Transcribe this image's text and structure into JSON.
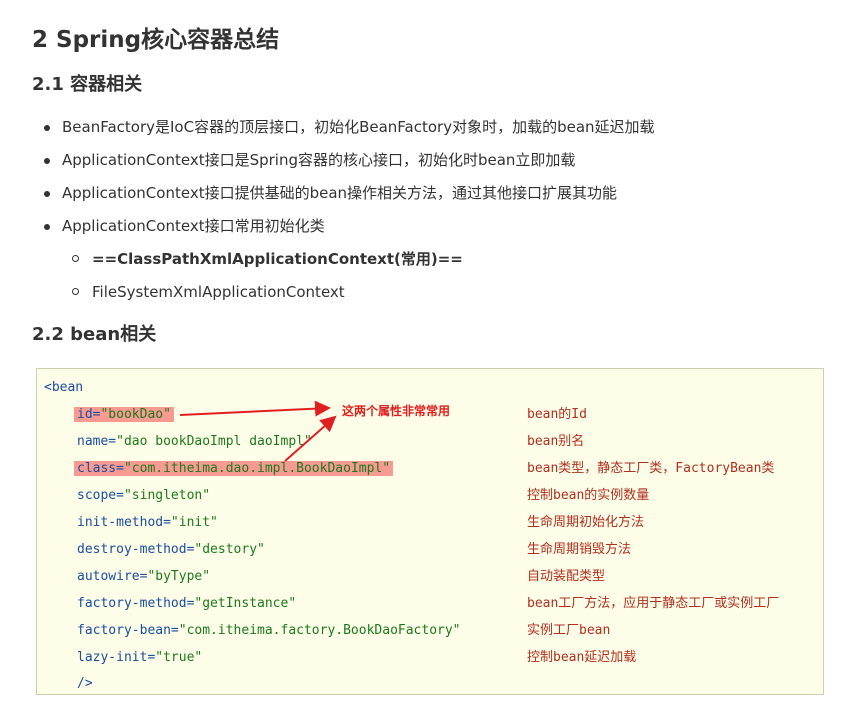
{
  "heading": "2 Spring核心容器总结",
  "section1": {
    "title": "2.1 容器相关",
    "items": [
      "BeanFactory是IoC容器的顶层接口，初始化BeanFactory对象时，加载的bean延迟加载",
      "ApplicationContext接口是Spring容器的核心接口，初始化时bean立即加载",
      "ApplicationContext接口提供基础的bean操作相关方法，通过其他接口扩展其功能",
      "ApplicationContext接口常用初始化类"
    ],
    "subitems": [
      "==ClassPathXmlApplicationContext(常用)==",
      "FileSystemXmlApplicationContext"
    ]
  },
  "section2": {
    "title": "2.2 bean相关",
    "code": {
      "open": "<bean",
      "close": "/>",
      "attributes": [
        {
          "name": "id=",
          "value": "\"bookDao\"",
          "comment": "bean的Id",
          "highlighted": true
        },
        {
          "name": "name=",
          "value": "\"dao bookDaoImpl daoImpl\"",
          "comment": "bean别名",
          "highlighted": false
        },
        {
          "name": "class=",
          "value": "\"com.itheima.dao.impl.BookDaoImpl\"",
          "comment": "bean类型，静态工厂类，FactoryBean类",
          "highlighted": true
        },
        {
          "name": "scope=",
          "value": "\"singleton\"",
          "comment": "控制bean的实例数量",
          "highlighted": false
        },
        {
          "name": "init-method=",
          "value": "\"init\"",
          "comment": "生命周期初始化方法",
          "highlighted": false
        },
        {
          "name": "destroy-method=",
          "value": "\"destory\"",
          "comment": "生命周期销毁方法",
          "highlighted": false
        },
        {
          "name": "autowire=",
          "value": "\"byType\"",
          "comment": "自动装配类型",
          "highlighted": false
        },
        {
          "name": "factory-method=",
          "value": "\"getInstance\"",
          "comment": "bean工厂方法，应用于静态工厂或实例工厂",
          "highlighted": false
        },
        {
          "name": "factory-bean=",
          "value": "\"com.itheima.factory.BookDaoFactory\"",
          "comment": "实例工厂bean",
          "highlighted": false
        },
        {
          "name": "lazy-init=",
          "value": "\"true\"",
          "comment": "控制bean延迟加载",
          "highlighted": false
        }
      ],
      "annotation": "这两个属性非常常用"
    }
  },
  "colors": {
    "keyword": "#1a4ea0",
    "string": "#1c7a1c",
    "comment": "#b03020",
    "highlight": "#f79a92",
    "annotation": "#e02020",
    "code_background": "#fdfde8"
  }
}
